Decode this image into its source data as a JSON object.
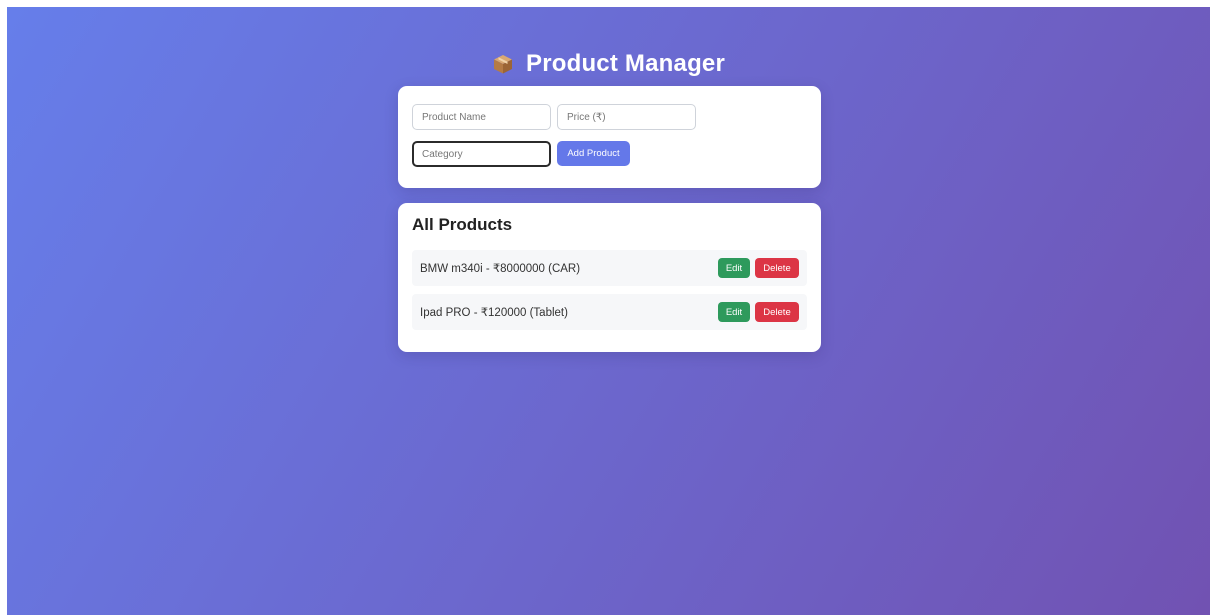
{
  "header": {
    "title": "Product Manager",
    "icon": "package-icon"
  },
  "form": {
    "name_placeholder": "Product Name",
    "price_placeholder": "Price (₹)",
    "category_placeholder": "Category",
    "add_label": "Add Product"
  },
  "products": {
    "heading": "All Products",
    "items": [
      {
        "text": "BMW m340i - ₹8000000 (CAR)",
        "edit_label": "Edit",
        "delete_label": "Delete"
      },
      {
        "text": "Ipad PRO - ₹120000 (Tablet)",
        "edit_label": "Edit",
        "delete_label": "Delete"
      }
    ]
  },
  "colors": {
    "gradient_start": "#667eea",
    "gradient_end": "#7152b2",
    "primary": "#6478e9",
    "edit": "#2e9a5c",
    "delete": "#dc3545"
  }
}
